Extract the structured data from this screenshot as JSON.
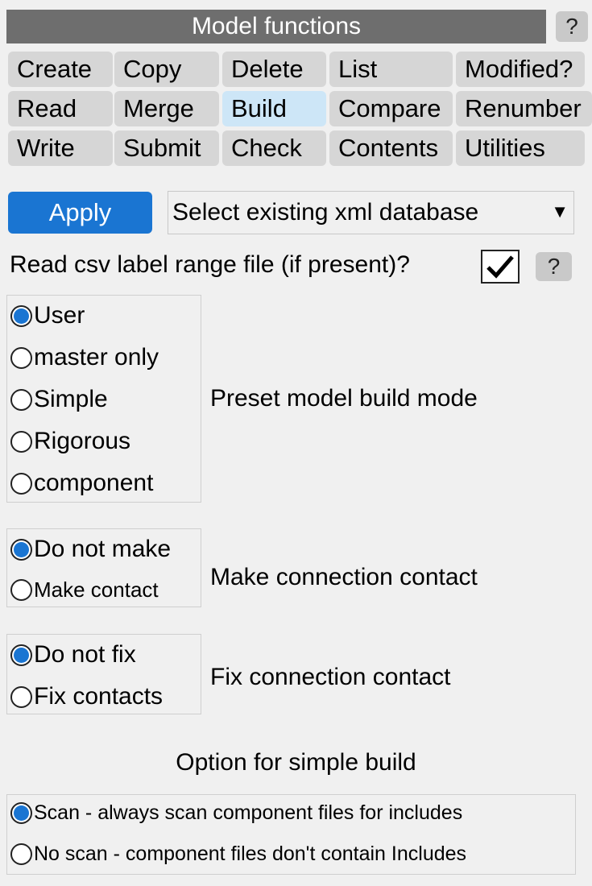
{
  "header": {
    "title": "Model functions",
    "help_label": "?"
  },
  "tabs": {
    "create": "Create",
    "copy": "Copy",
    "delete": "Delete",
    "list": "List",
    "modified": "Modified?",
    "read": "Read",
    "merge": "Merge",
    "build": "Build",
    "compare": "Compare",
    "renumber": "Renumber",
    "write": "Write",
    "submit": "Submit",
    "check": "Check",
    "contents": "Contents",
    "utilities": "Utilities",
    "active": "Build"
  },
  "toolbar": {
    "apply_label": "Apply",
    "database_value": "Select existing xml database",
    "dropdown_arrow": "▼"
  },
  "csv_option": {
    "label": "Read csv label range file (if present)?",
    "checked": true,
    "help_label": "?"
  },
  "build_mode": {
    "label": "Preset model build mode",
    "options": [
      "User",
      "master only",
      "Simple",
      "Rigorous",
      "component"
    ],
    "selected": "User"
  },
  "connection_contact": {
    "label": "Make connection contact",
    "options": [
      "Do not make",
      "Make contact"
    ],
    "selected": "Do not make"
  },
  "fix_contact": {
    "label": "Fix connection contact",
    "options": [
      "Do not fix",
      "Fix contacts"
    ],
    "selected": "Do not fix"
  },
  "simple_build": {
    "title": "Option for simple build",
    "options": [
      "Scan - always scan component files for includes",
      "No scan - component files don't contain Includes"
    ],
    "selected": "Scan - always scan component files for includes"
  }
}
